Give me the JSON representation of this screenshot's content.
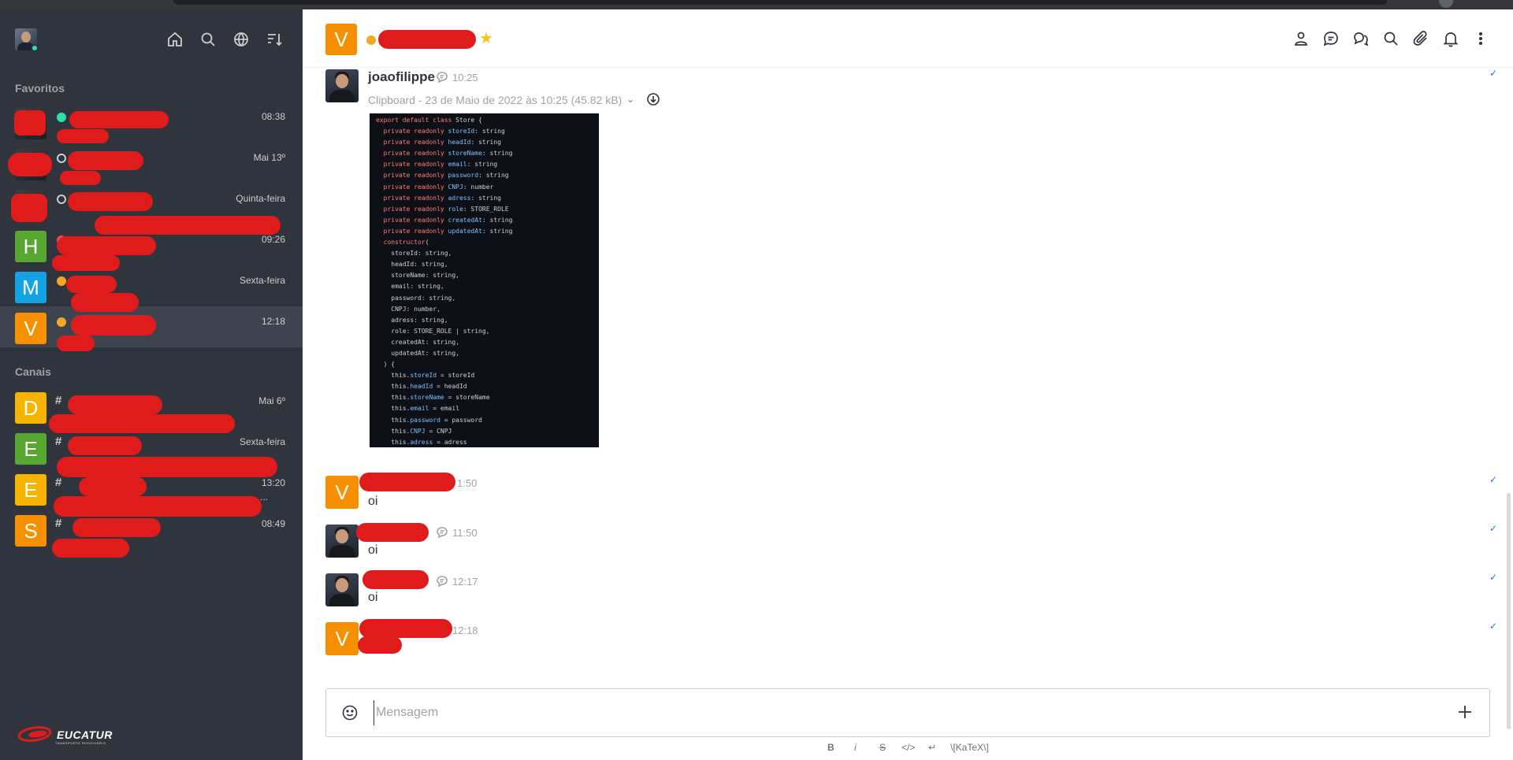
{
  "sidebar": {
    "favorites_title": "Favoritos",
    "channels_title": "Canais",
    "favorites": [
      {
        "letter": "",
        "status": "online",
        "time": "08:38"
      },
      {
        "letter": "",
        "status": "offline",
        "time": "Mai 13º"
      },
      {
        "letter": "",
        "status": "offline",
        "time": "Quinta-feira"
      },
      {
        "letter": "H",
        "color": "#57a732",
        "status": "busy",
        "time": "09:26"
      },
      {
        "letter": "M",
        "color": "#13a2e3",
        "status": "away",
        "time": "Sexta-feira"
      },
      {
        "letter": "V",
        "color": "#f79000",
        "status": "away",
        "time": "12:18"
      }
    ],
    "channels": [
      {
        "letter": "D",
        "color": "#f5b400",
        "time": "Mai 6º"
      },
      {
        "letter": "E",
        "color": "#57a732",
        "time": "Sexta-feira"
      },
      {
        "letter": "E",
        "color": "#f5b400",
        "time": "13:20",
        "ellipsis": "..."
      },
      {
        "letter": "S",
        "color": "#f79000",
        "time": "08:49"
      }
    ],
    "logo_text": "EUCATUR",
    "logo_sub": "TRANSPORTE RODOVIÁRIO",
    "icons": [
      "home-icon",
      "search-icon",
      "directory-icon",
      "sort-icon"
    ]
  },
  "room": {
    "avatar_letter": "V",
    "header_icons": [
      "user-info-icon",
      "discussion-icon",
      "threads-icon",
      "search-icon",
      "attachment-icon",
      "notifications-icon",
      "kebab-icon"
    ]
  },
  "messages": [
    {
      "author": "joaofilippe",
      "time": "10:25",
      "attachment": "Clipboard - 23 de Maio de 2022 às 10:25 (45.82 kB)"
    },
    {
      "author": "",
      "avatar_letter": "V",
      "time": "1:50",
      "text": "oi"
    },
    {
      "author": "",
      "time": "11:50",
      "text": "oi"
    },
    {
      "author": "",
      "time": "12:17",
      "text": "oi"
    },
    {
      "author": "",
      "avatar_letter": "V",
      "time": "12:18",
      "text": ""
    }
  ],
  "code_lines": [
    "export default class Store {",
    "  private readonly storeId: string",
    "  private readonly headId: string",
    "  private readonly storeName: string",
    "  private readonly email: string",
    "  private readonly password: string",
    "  private readonly CNPJ: number",
    "  private readonly adress: string",
    "  private readonly role: STORE_ROLE",
    "  private readonly createdAt: string",
    "  private readonly updatedAt: string",
    "  constructor(",
    "    storeId: string,",
    "    headId: string,",
    "    storeName: string,",
    "    email: string,",
    "    password: string,",
    "    CNPJ: number,",
    "    adress: string,",
    "    role: STORE_ROLE | string,",
    "    createdAt: string,",
    "    updatedAt: string,",
    "  ) {",
    "    this.storeId = storeId",
    "    this.headId = headId",
    "    this.storeName = storeName",
    "    this.email = email",
    "    this.password = password",
    "    this.CNPJ = CNPJ",
    "    this.adress = adress"
  ],
  "composer": {
    "placeholder": "Mensagem",
    "toolbar": [
      "B",
      "i",
      "S",
      "</>",
      "↵",
      "\\[KaTeX\\]"
    ]
  },
  "colors": {
    "sidebar_bg": "#2f343d",
    "accent": "#1d74f5",
    "redaction": "#e01b1b"
  }
}
